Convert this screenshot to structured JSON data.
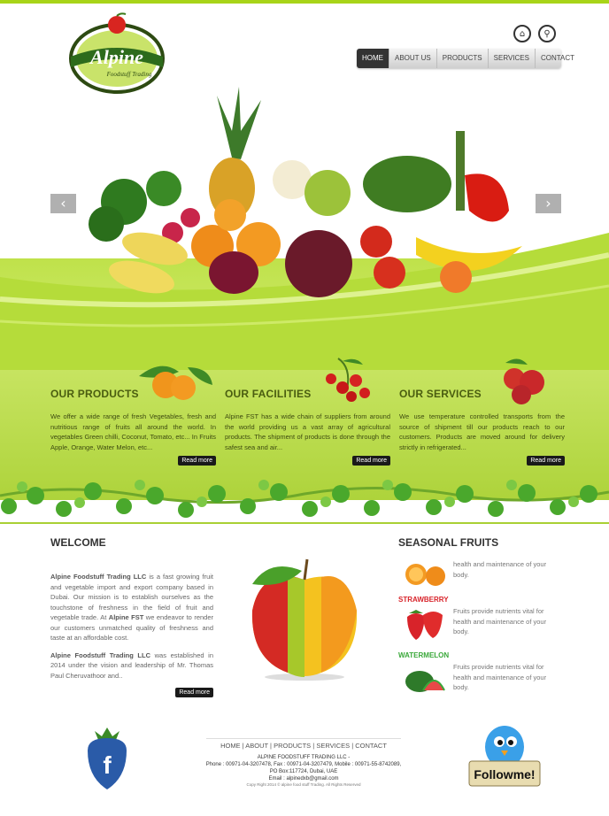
{
  "logo": {
    "name": "Alpine",
    "tagline": "Foodstuff Trading"
  },
  "header_icons": [
    {
      "name": "home-icon",
      "glyph": "⌂"
    },
    {
      "name": "link-icon",
      "glyph": "⚲"
    }
  ],
  "nav": [
    "HOME",
    "ABOUT US",
    "PRODUCTS",
    "SERVICES",
    "CONTACT"
  ],
  "slider": {
    "prev": "‹",
    "next": "›"
  },
  "columns": [
    {
      "title": "OUR PRODUCTS",
      "text": "We offer a wide range of fresh Vegetables, fresh and nutritious range of fruits all around the world. In vegetables Green chilli, Coconut, Tomato, etc... In Fruits Apple, Orange, Water Melon, etc...",
      "more": "Read more"
    },
    {
      "title": "OUR FACILITIES",
      "text": "Alpine FST has a wide chain of suppliers from around the world providing us a vast array of agricultural products. The shipment of products is done through the safest sea and air...",
      "more": "Read more"
    },
    {
      "title": "OUR SERVICES",
      "text": "We use temperature controlled transports from the source of shipment till our products reach to our customers. Products are moved around for delivery strictly in refrigerated...",
      "more": "Read more"
    }
  ],
  "welcome": {
    "title": "WELCOME",
    "p1_company": "Alpine Foodstuff Trading LLC",
    "p1_a": " is a fast growing fruit and vegetable import and export company based in Dubai. Our mission is to establish ourselves as the touchstone of freshness in the field of fruit and vegetable trade. At ",
    "p1_brand": "Alpine FST",
    "p1_b": " we endeavor to render our customers unmatched quality of freshness and taste at an affordable cost.",
    "p2_company": "Alpine Foodstuff Trading LLC",
    "p2_rest": " was established in 2014 under the vision and leadership of Mr. Thomas Paul Cheruvathoor and..",
    "more": "Read more"
  },
  "seasonal": {
    "title": "SEASONAL FRUITS",
    "items": [
      {
        "label": "",
        "text": "health and maintenance of your body.",
        "color": "#e8862a"
      },
      {
        "label": "STRAWBERRY",
        "text": "Fruits provide nutrients vital for health and maintenance of your body.",
        "color": "#d8232a"
      },
      {
        "label": "WATERMELON",
        "text": "Fruits provide nutrients vital for health and maintenance of your body.",
        "color": "#3aa83a"
      }
    ]
  },
  "footer": {
    "links": [
      "HOME",
      "ABOUT",
      "PRODUCTS",
      "SERVICES",
      "CONTACT"
    ],
    "company": "ALPINE FOODSTUFF TRADING LLC -",
    "phone": "Phone : 00971-04-3207478, Fax : 00971-04-3207479, Mobile : 00971-55-8742089,",
    "po": "PO Box:117724, Dubai, UAE",
    "email": "Email : alpinedxb@gmail.com",
    "copyright": "Copy Right 2014 © alpine food stuff Trading. All Rights Reserved",
    "follow": "Followme!"
  },
  "colors": {
    "accent": "#a8d418",
    "dark_green": "#4a5d10",
    "strawberry": "#d8232a",
    "watermelon": "#3aa83a"
  }
}
